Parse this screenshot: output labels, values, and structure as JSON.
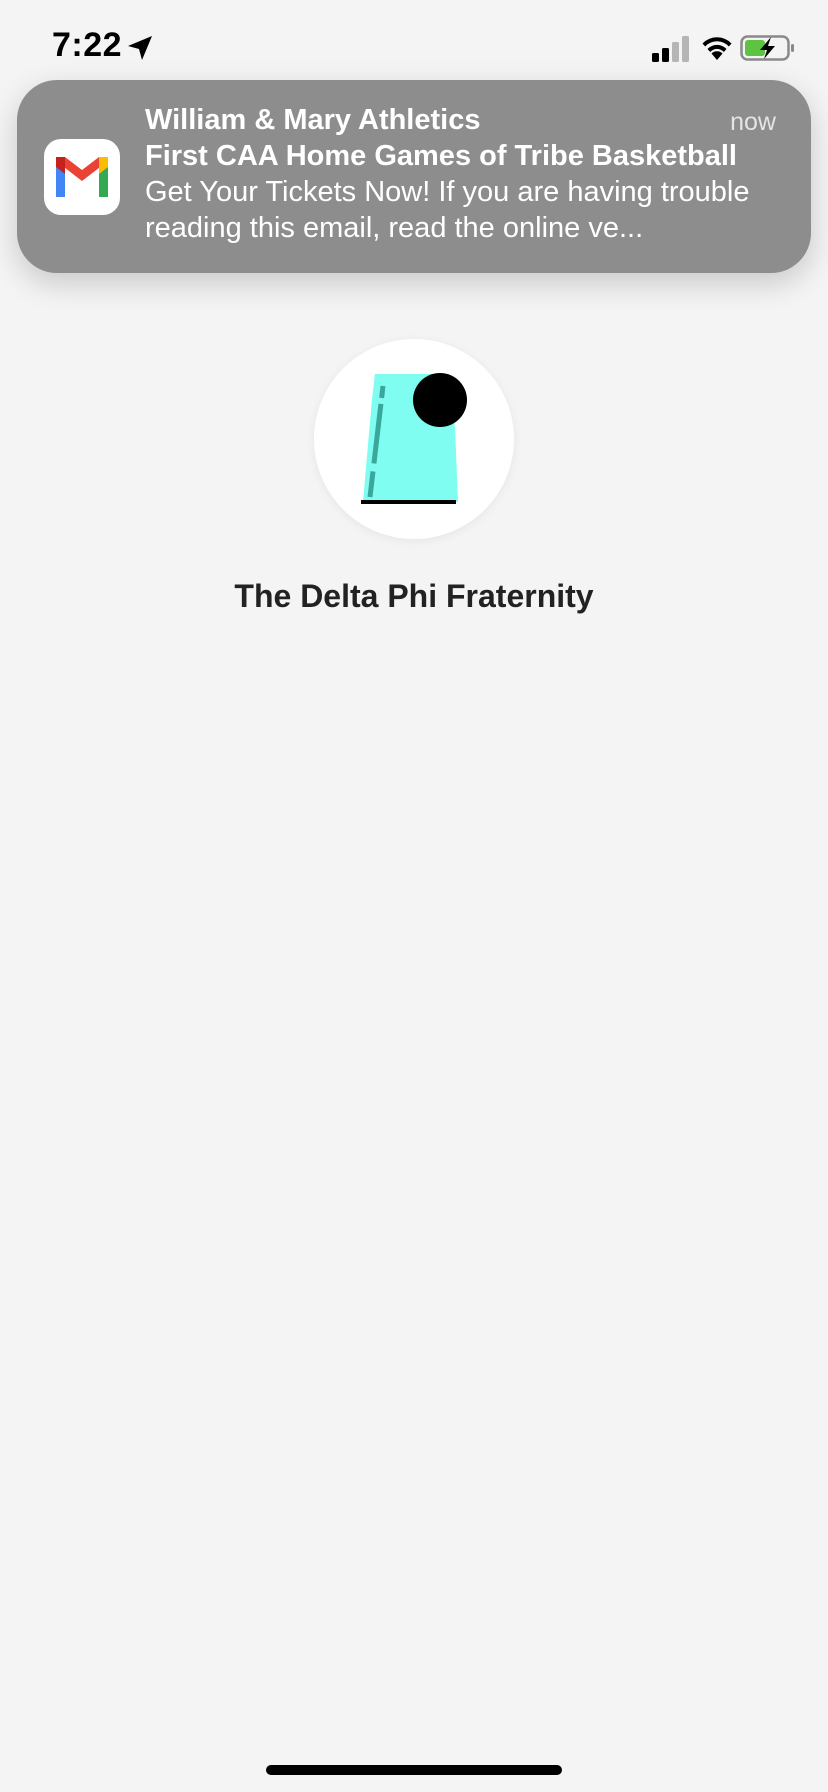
{
  "status_bar": {
    "time": "7:22",
    "icons": [
      "location-arrow-icon",
      "cellular-signal-icon",
      "wifi-icon",
      "battery-charging-icon"
    ]
  },
  "notification": {
    "app_icon": "gmail-icon",
    "sender": "William & Mary Athletics",
    "time": "now",
    "subject": "First CAA Home Games of Tribe Basketball",
    "body": "Get Your Tickets Now! If you are having trouble reading this email, read the online ve..."
  },
  "contact": {
    "avatar_icon": "cup-and-ball-icon",
    "name": "The Delta Phi Fraternity"
  },
  "colors": {
    "background": "#f4f4f4",
    "notification_bg": "#8d8d8d",
    "avatar_cup": "#7ffdf1",
    "battery_fill": "#5cc441"
  }
}
